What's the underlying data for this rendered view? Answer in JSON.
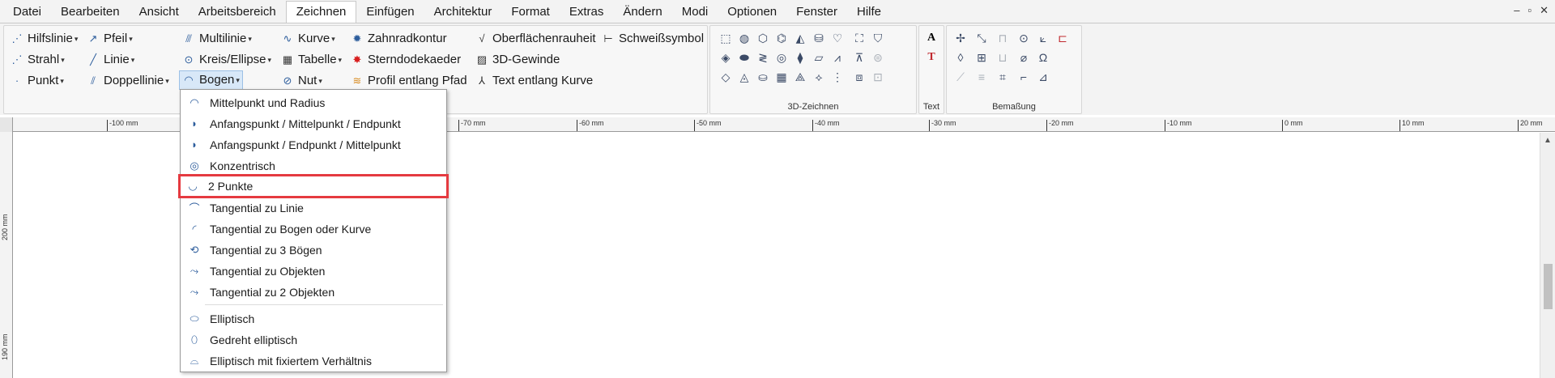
{
  "menubar": {
    "items": [
      "Datei",
      "Bearbeiten",
      "Ansicht",
      "Arbeitsbereich",
      "Zeichnen",
      "Einfügen",
      "Architektur",
      "Format",
      "Extras",
      "Ändern",
      "Modi",
      "Optionen",
      "Fenster",
      "Hilfe"
    ],
    "active": "Zeichnen",
    "window_controls": [
      "–",
      "▫",
      "✕"
    ]
  },
  "ribbon": {
    "col1": [
      "Hilfslinie",
      "Strahl",
      "Punkt"
    ],
    "col2": [
      "Pfeil",
      "Linie",
      "Doppellinie"
    ],
    "col3": [
      "Multilinie",
      "Kreis/Ellipse",
      "Bogen"
    ],
    "col4": [
      "Kurve",
      "Tabelle",
      "Nut"
    ],
    "col5": [
      "Zahnradkontur",
      "Sterndodekaeder",
      "Profil entlang Pfad"
    ],
    "col6": [
      "Oberflächenrauheit",
      "3D-Gewinde",
      "Text entlang Kurve"
    ],
    "col7": [
      "Schweißsymbol"
    ],
    "group_3d": "3D-Zeichnen",
    "group_text": "Text",
    "group_dim": "Bemaßung"
  },
  "ruler": {
    "top_labels": [
      "-100 mm",
      "-70 mm",
      "-60 mm",
      "-50 mm",
      "-40 mm",
      "-30 mm",
      "-20 mm",
      "-10 mm",
      "0 mm",
      "10 mm",
      "20 mm"
    ],
    "left_labels": [
      "200 mm",
      "190 mm"
    ]
  },
  "dropdown": {
    "items": [
      "Mittelpunkt und Radius",
      "Anfangspunkt / Mittelpunkt / Endpunkt",
      "Anfangspunkt / Endpunkt / Mittelpunkt",
      "Konzentrisch",
      "2 Punkte",
      "Tangential zu Linie",
      "Tangential zu Bogen oder Kurve",
      "Tangential zu 3 Bögen",
      "Tangential zu Objekten",
      "Tangential zu 2 Objekten",
      "Elliptisch",
      "Gedreht elliptisch",
      "Elliptisch mit fixiertem Verhältnis"
    ],
    "selected": "2 Punkte"
  },
  "colors": {
    "highlight": "#e53a40",
    "icon_blue": "#2d5d9c"
  }
}
